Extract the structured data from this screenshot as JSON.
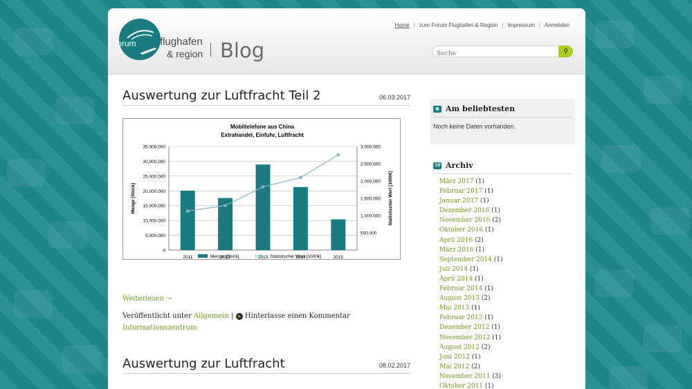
{
  "header": {
    "logo_forum": "forum",
    "logo_flughafen": "flughafen",
    "logo_region": "& region",
    "blog_label": "Blog",
    "nav": [
      "Home",
      "zum Forum Flughafen & Region",
      "Impressum",
      "Anmelden"
    ],
    "search_placeholder": "Suche",
    "search_icon": "search-icon"
  },
  "post1": {
    "title": "Auswertung zur Luftfracht Teil 2",
    "date": "06.03.2017",
    "readmore": "Weiterlesen →",
    "meta_prefix": "Veröffentlicht unter",
    "category": "Allgemein",
    "comment": "Hinterlasse einen Kommentar",
    "tag": "Informationszentrum"
  },
  "post2": {
    "title": "Auswertung zur Luftfracht",
    "date": "08.02.2017"
  },
  "chart_data": {
    "type": "bar",
    "title": "Mobiltelefone aus China",
    "subtitle": "Extrahandel, Einfuhr, Luftfracht",
    "categories": [
      "2011",
      "2012",
      "2013",
      "2014",
      "2015"
    ],
    "series": [
      {
        "name": "Menge [Stück]",
        "type": "bar",
        "axis": "left",
        "color": "#187c82",
        "values": [
          20100000,
          17600000,
          28900000,
          21300000,
          10400000
        ]
      },
      {
        "name": "Statistischer Wert [1000€]",
        "type": "line",
        "axis": "right",
        "color": "#8ab4c8",
        "values": [
          1130000,
          1290000,
          1830000,
          2100000,
          2760000
        ]
      }
    ],
    "ylabel": "Menge [Stück]",
    "ylabel_right": "Statistischer Wert [1000€]",
    "ylim": [
      0,
      35000000
    ],
    "ylim_right": [
      0,
      3000000
    ],
    "yticks": [
      "0",
      "5.000.000",
      "10.000.000",
      "15.000.000",
      "20.000.000",
      "25.000.000",
      "30.000.000",
      "35.000.000"
    ],
    "yticks_right": [
      "500.000",
      "1.000.000",
      "1.500.000",
      "2.000.000",
      "2.500.000",
      "3.000.000"
    ],
    "legend": "bottom",
    "grid": true
  },
  "sidebar": {
    "popular_title": "Am beliebtesten",
    "popular_text": "Noch keine Daten vorhanden.",
    "archive_title": "Archiv",
    "archive": [
      {
        "month": "März 2017",
        "count": "(1)"
      },
      {
        "month": "Februar 2017",
        "count": "(1)"
      },
      {
        "month": "Januar 2017",
        "count": "(1)"
      },
      {
        "month": "Dezember 2016",
        "count": "(1)"
      },
      {
        "month": "November 2016",
        "count": "(2)"
      },
      {
        "month": "Oktober 2016",
        "count": "(1)"
      },
      {
        "month": "April 2016",
        "count": "(2)"
      },
      {
        "month": "März 2016",
        "count": "(1)"
      },
      {
        "month": "September 2014",
        "count": "(1)"
      },
      {
        "month": "Juli 2014",
        "count": "(1)"
      },
      {
        "month": "April 2014",
        "count": "(1)"
      },
      {
        "month": "Februar 2014",
        "count": "(1)"
      },
      {
        "month": "August 2013",
        "count": "(2)"
      },
      {
        "month": "Mai 2013",
        "count": "(1)"
      },
      {
        "month": "Februar 2013",
        "count": "(1)"
      },
      {
        "month": "Dezember 2012",
        "count": "(1)"
      },
      {
        "month": "November 2012",
        "count": "(1)"
      },
      {
        "month": "August 2012",
        "count": "(2)"
      },
      {
        "month": "Juni 2012",
        "count": "(1)"
      },
      {
        "month": "Mai 2012",
        "count": "(2)"
      },
      {
        "month": "November 2011",
        "count": "(3)"
      },
      {
        "month": "Oktober 2011",
        "count": "(1)"
      }
    ]
  }
}
